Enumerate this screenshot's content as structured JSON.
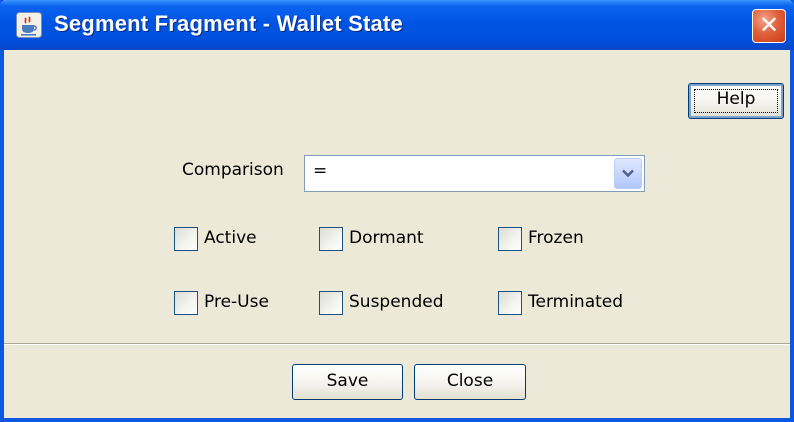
{
  "window": {
    "title": "Segment Fragment - Wallet State",
    "icon": "java-cup-icon",
    "close_symbol": "✕"
  },
  "toolbar": {
    "help_label": "Help"
  },
  "comparison": {
    "label": "Comparison",
    "value": "=",
    "dropdown_icon": "chevron-down-icon"
  },
  "states": [
    {
      "label": "Active",
      "checked": false
    },
    {
      "label": "Dormant",
      "checked": false
    },
    {
      "label": "Frozen",
      "checked": false
    },
    {
      "label": "Pre-Use",
      "checked": false
    },
    {
      "label": "Suspended",
      "checked": false
    },
    {
      "label": "Terminated",
      "checked": false
    }
  ],
  "footer": {
    "save_label": "Save",
    "close_label": "Close"
  },
  "colors": {
    "titlebar": "#0054e3",
    "dialog_bg": "#ece9d8",
    "close_button": "#e2613c",
    "button_border": "#003c74"
  }
}
